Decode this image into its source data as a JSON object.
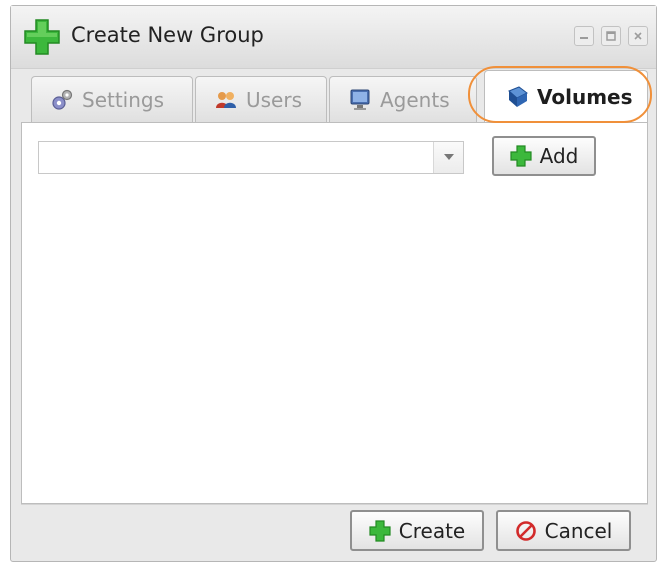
{
  "dialog": {
    "title": "Create New Group",
    "title_icon": "green-plus-icon",
    "window_controls": [
      "minimize-icon",
      "maximize-icon",
      "close-icon"
    ]
  },
  "tabs": [
    {
      "label": "Settings",
      "icon": "gears-icon",
      "active": false
    },
    {
      "label": "Users",
      "icon": "users-icon",
      "active": false
    },
    {
      "label": "Agents",
      "icon": "computer-icon",
      "active": false
    },
    {
      "label": "Volumes",
      "icon": "volume-icon",
      "active": true
    }
  ],
  "volumes_panel": {
    "select_value": "",
    "add_label": "Add"
  },
  "footer": {
    "create_label": "Create",
    "cancel_label": "Cancel"
  },
  "colors": {
    "highlight_ring": "#f0903a",
    "plus_green": "#3cb83c",
    "cancel_red": "#d22a2a"
  }
}
